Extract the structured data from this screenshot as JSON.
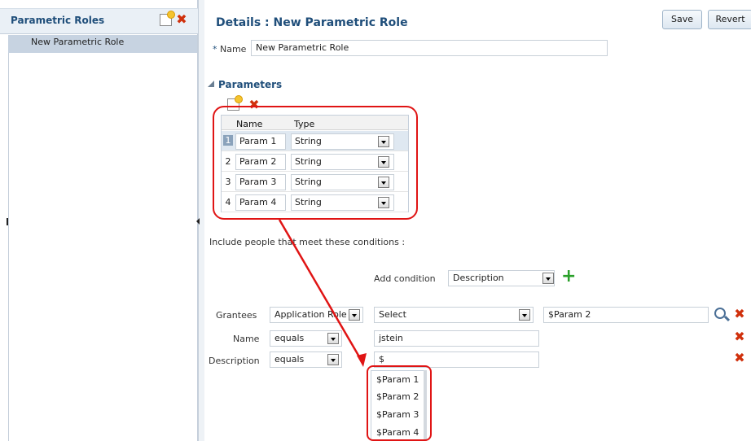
{
  "left": {
    "title": "Parametric Roles",
    "roles": [
      "New Parametric Role"
    ],
    "new_icon": "new-doc-icon",
    "delete_icon": "delete-x-icon"
  },
  "main": {
    "title": "Details : New Parametric Role",
    "save_label": "Save",
    "revert_label": "Revert",
    "name_label": "Name",
    "required_mark": "*",
    "name_value": "New Parametric Role",
    "parameters_title": "Parameters",
    "table": {
      "headers": [
        "Name",
        "Type"
      ],
      "rows": [
        {
          "num": "1",
          "name": "Param 1",
          "type": "String"
        },
        {
          "num": "2",
          "name": "Param 2",
          "type": "String"
        },
        {
          "num": "3",
          "name": "Param 3",
          "type": "String"
        },
        {
          "num": "4",
          "name": "Param 4",
          "type": "String"
        }
      ]
    },
    "include_text": "Include people that meet these conditions :",
    "add_condition_label": "Add condition",
    "add_condition_value": "Description",
    "conditions": [
      {
        "label": "Grantees",
        "op": "Application Role",
        "value": "Select",
        "extra": "$Param 2"
      },
      {
        "label": "Name",
        "op": "equals",
        "value": "jstein"
      },
      {
        "label": "Description",
        "op": "equals",
        "value": "$"
      }
    ],
    "suggestions": [
      "$Param 1",
      "$Param 2",
      "$Param 3",
      "$Param 4"
    ]
  },
  "colors": {
    "accent": "#1f4e7a",
    "annotation": "#e01414",
    "delete": "#d0300c",
    "add": "#2aa02a"
  }
}
